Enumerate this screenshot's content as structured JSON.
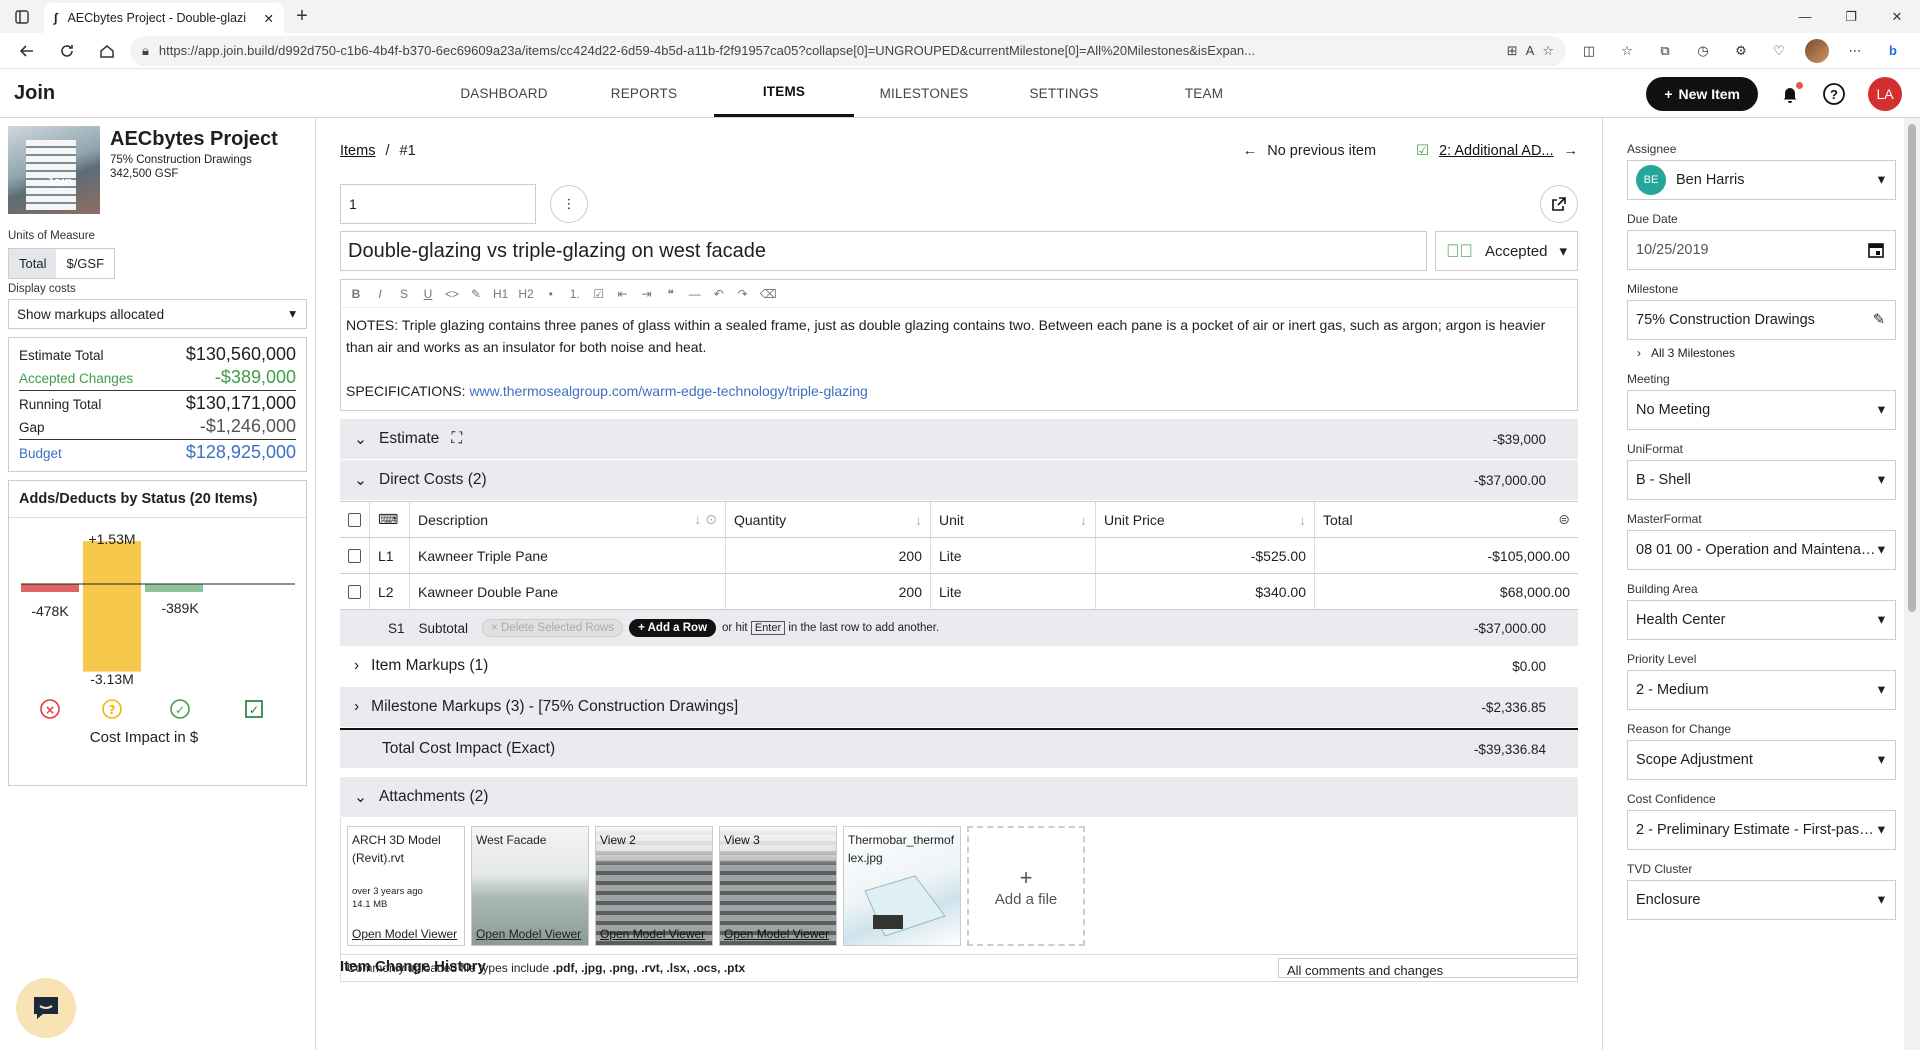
{
  "browser": {
    "tab_title": "AECbytes Project - Double-glazi",
    "url": "https://app.join.build/d992d750-c1b6-4b4f-b370-6ec69609a23a/items/cc424d22-6d59-4b5d-a11b-f2f91957ca05?collapse[0]=UNGROUPED&currentMilestone[0]=All%20Milestones&isExpan..."
  },
  "app": {
    "logo": "Join",
    "nav": [
      "DASHBOARD",
      "REPORTS",
      "ITEMS",
      "MILESTONES",
      "SETTINGS",
      "TEAM"
    ],
    "active_nav": "ITEMS",
    "new_item_label": "New Item",
    "user_initials": "LA"
  },
  "project": {
    "name": "AECbytes Project",
    "milestone": "75% Construction Drawings",
    "area": "342,500 GSF",
    "thumb_label": "Join"
  },
  "units": {
    "label": "Units of Measure",
    "options": [
      "Total",
      "$/GSF"
    ],
    "selected": "Total"
  },
  "display_costs": {
    "label": "Display costs",
    "value": "Show markups allocated"
  },
  "totals": [
    {
      "label": "Estimate Total",
      "value": "$130,560,000",
      "style": "plain"
    },
    {
      "label": "Accepted Changes",
      "value": "-$389,000",
      "style": "green"
    },
    {
      "label": "Running Total",
      "value": "$130,171,000",
      "style": "sep"
    },
    {
      "label": "Gap",
      "value": "-$1,246,000",
      "style": "gray"
    },
    {
      "label": "Budget",
      "value": "$128,925,000",
      "style": "blue"
    }
  ],
  "status_chart": {
    "title": "Adds/Deducts by Status (20 Items)",
    "footer": "Cost Impact in $",
    "colors": {
      "rejected": "#e06666",
      "pending": "#f6c84c",
      "accepted": "#8fc49a"
    },
    "chart_data": {
      "type": "bar",
      "categories": [
        "Rejected",
        "Pending",
        "Accepted",
        "Incorporated"
      ],
      "series": [
        {
          "name": "Adds",
          "values": [
            0,
            1.53,
            0,
            0
          ]
        },
        {
          "name": "Deducts",
          "values": [
            -0.478,
            -3.13,
            -0.389,
            0
          ]
        }
      ],
      "labels": {
        "rejected_deduct": "-478K",
        "pending_add": "+1.53M",
        "pending_deduct": "-3.13M",
        "accepted_deduct": "-389K"
      }
    }
  },
  "item": {
    "breadcrumb_link": "Items",
    "breadcrumb_sep": "/",
    "breadcrumb_current": "#1",
    "prev_label": "No previous item",
    "next_label": "2: Additional AD...",
    "number": "1",
    "title": "Double-glazing vs triple-glazing on west facade",
    "status": "Accepted",
    "notes": "NOTES: Triple glazing contains three panes of glass within a sealed frame, just as double glazing contains two. Between each pane is a pocket of air or inert gas, such as argon; argon is heavier than air and works as an insulator for both noise and heat.",
    "spec_label": "SPECIFICATIONS:",
    "spec_link": "www.thermosealgroup.com/warm-edge-technology/triple-glazing",
    "toolbar": [
      "B",
      "I",
      "S",
      "U",
      "<>",
      "✎",
      "H1",
      "H2",
      "•",
      "1.",
      "☑",
      "⇤",
      "⇥",
      "❝",
      "—",
      "↶",
      "↷",
      "⌫"
    ]
  },
  "estimate": {
    "label": "Estimate",
    "total": "-$39,000",
    "direct_costs_label": "Direct Costs (2)",
    "direct_costs_total": "-$37,000.00",
    "columns": [
      "Description",
      "Quantity",
      "Unit",
      "Unit Price",
      "Total"
    ],
    "rows": [
      {
        "id": "L1",
        "description": "Kawneer Triple Pane",
        "quantity": "200",
        "unit": "Lite",
        "unit_price": "-$525.00",
        "total": "-$105,000.00"
      },
      {
        "id": "L2",
        "description": "Kawneer Double Pane",
        "quantity": "200",
        "unit": "Lite",
        "unit_price": "$340.00",
        "total": "$68,000.00"
      }
    ],
    "subtotal_id": "S1",
    "subtotal_label": "Subtotal",
    "delete_rows_label": "× Delete Selected Rows",
    "add_row_label": "+ Add a Row",
    "hint_pre": "or hit",
    "hint_key": "Enter",
    "hint_post": "in the last row to add another.",
    "subtotal_value": "-$37,000.00",
    "item_markups_label": "Item Markups (1)",
    "item_markups_value": "$0.00",
    "milestone_markups_label": "Milestone Markups (3) - [75% Construction Drawings]",
    "milestone_markups_value": "-$2,336.85",
    "total_impact_label": "Total Cost Impact (Exact)",
    "total_impact_value": "-$39,336.84"
  },
  "attachments": {
    "label": "Attachments (2)",
    "files": [
      {
        "name": "ARCH 3D Model (Revit).rvt",
        "meta1": "over 3 years ago",
        "meta2": "14.1 MB",
        "link": "Open Model Viewer"
      },
      {
        "name": "West Facade",
        "link": "Open Model Viewer"
      },
      {
        "name": "View 2",
        "link": "Open Model Viewer"
      },
      {
        "name": "View 3",
        "link": "Open Model Viewer"
      },
      {
        "name": "Thermobar_thermoflex.jpg"
      }
    ],
    "add_file_label": "Add a file",
    "file_types_pre": "Commonly uploaded file types include",
    "file_types": ".pdf, .jpg, .png, .rvt, .lsx, .ocs, .ptx"
  },
  "history": {
    "label": "Item Change History",
    "filter": "All comments and changes"
  },
  "sidebar": {
    "assignee": {
      "label": "Assignee",
      "initials": "BE",
      "value": "Ben Harris"
    },
    "due_date": {
      "label": "Due Date",
      "value": "10/25/2019"
    },
    "milestone": {
      "label": "Milestone",
      "value": "75% Construction Drawings",
      "all": "All 3 Milestones"
    },
    "meeting": {
      "label": "Meeting",
      "value": "No Meeting"
    },
    "uniformat": {
      "label": "UniFormat",
      "value": "B - Shell"
    },
    "masterformat": {
      "label": "MasterFormat",
      "value": "08 01 00 - Operation and Maintenanc..."
    },
    "building_area": {
      "label": "Building Area",
      "value": "Health Center"
    },
    "priority": {
      "label": "Priority Level",
      "value": "2 - Medium"
    },
    "reason": {
      "label": "Reason for Change",
      "value": "Scope Adjustment"
    },
    "confidence": {
      "label": "Cost Confidence",
      "value": "2 - Preliminary Estimate - First-pass o..."
    },
    "tvd": {
      "label": "TVD Cluster",
      "value": "Enclosure"
    }
  }
}
